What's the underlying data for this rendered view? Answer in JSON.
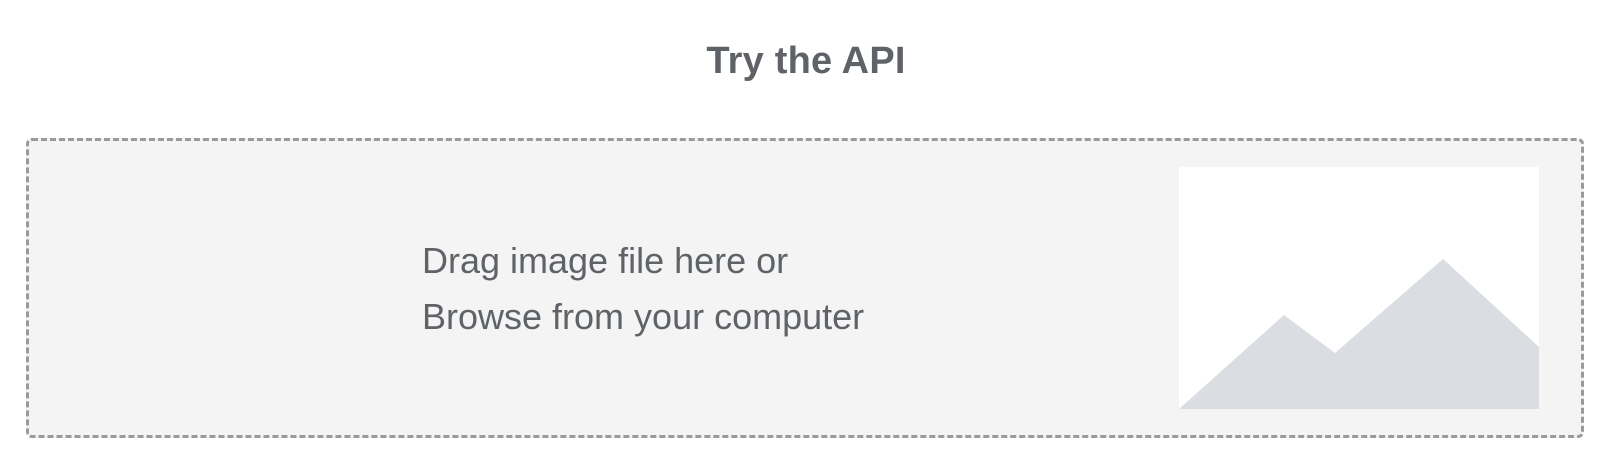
{
  "header": {
    "title": "Try the API"
  },
  "dropzone": {
    "line1": "Drag image file here or",
    "line2": "Browse from your computer",
    "placeholder_icon": "image-placeholder-icon"
  },
  "colors": {
    "text": "#5f6368",
    "dropzone_bg": "#f4f4f4",
    "dropzone_border": "#9a9a9a",
    "mountain": "#dadee2"
  }
}
